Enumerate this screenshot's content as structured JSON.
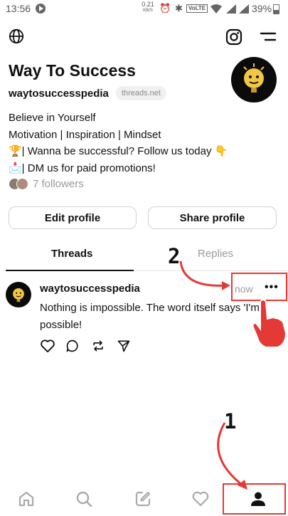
{
  "status_bar": {
    "time": "13:56",
    "network_speed": "0.21",
    "network_unit": "KB/S",
    "network_type": "VoLTE",
    "battery": "39%",
    "icons": [
      "play-icon",
      "alarm-icon",
      "bluetooth-icon",
      "volte-icon",
      "wifi-icon",
      "signal-icon",
      "battery-icon"
    ]
  },
  "top_bar": {
    "icons": [
      "globe-icon",
      "instagram-icon",
      "menu-icon"
    ]
  },
  "profile": {
    "name": "Way To Success",
    "handle": "waytosuccesspedia",
    "domain": "threads.net",
    "bio": [
      "Believe in Yourself",
      "Motivation | Inspiration | Mindset",
      "🏆| Wanna be successful? Follow us today 👇",
      "📩| DM us for paid promotions!"
    ],
    "followers": "7 followers"
  },
  "buttons": {
    "edit": "Edit profile",
    "share": "Share profile"
  },
  "tabs": {
    "threads": "Threads",
    "replies": "Replies",
    "active": "Threads"
  },
  "post": {
    "username": "waytosuccesspedia",
    "time": "now",
    "more": "•••",
    "text": "Nothing is impossible. The word itself says 'I'm possible!",
    "actions": [
      "heart-icon",
      "comment-icon",
      "repost-icon",
      "send-icon"
    ]
  },
  "bottom_nav": {
    "items": [
      "home-icon",
      "search-icon",
      "compose-icon",
      "activity-icon",
      "profile-icon"
    ],
    "active": "profile-icon"
  },
  "annotations": {
    "step1": "1",
    "step2": "2",
    "color": "#e53935"
  }
}
